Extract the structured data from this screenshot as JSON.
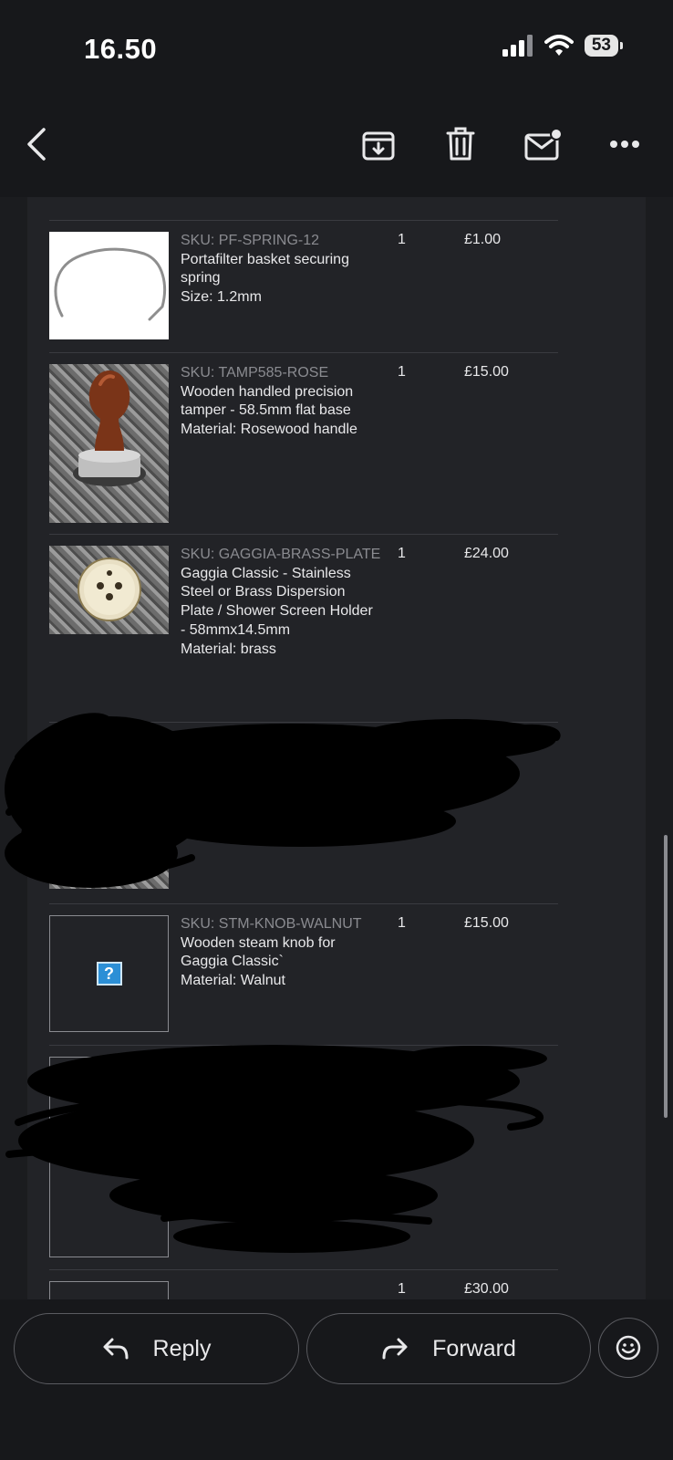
{
  "status_bar": {
    "time": "16.50",
    "battery": "53"
  },
  "app_bar": {
    "back_icon": "chevron-left-icon",
    "actions": [
      "archive-icon",
      "delete-icon",
      "mark-unread-icon",
      "more-icon"
    ]
  },
  "order_items": [
    {
      "sku": "SKU: PF-SPRING-12",
      "name": "Portafilter basket securing spring",
      "detail": "Size: 1.2mm",
      "qty": "1",
      "price": "£1.00"
    },
    {
      "sku": "SKU: TAMP585-ROSE",
      "name": "Wooden handled precision tamper - 58.5mm flat base",
      "detail": "Material: Rosewood handle",
      "qty": "1",
      "price": "£15.00"
    },
    {
      "sku": "SKU: GAGGIA-BRASS-PLATE",
      "name": "Gaggia Classic - Stainless Steel or Brass Dispersion Plate / Shower Screen Holder - 58mmx14.5mm",
      "detail": "Material: brass",
      "qty": "1",
      "price": "£24.00"
    },
    {
      "sku": "SKU: STM-KNOB-WALNUT",
      "name": "Wooden steam knob for Gaggia Classic`",
      "detail": "Material: Walnut",
      "qty": "1",
      "price": "£15.00"
    }
  ],
  "partial_item": {
    "qty": "1",
    "price": "£30.00"
  },
  "missing_image_glyph": "?",
  "bottom_bar": {
    "reply_label": "Reply",
    "forward_label": "Forward"
  }
}
